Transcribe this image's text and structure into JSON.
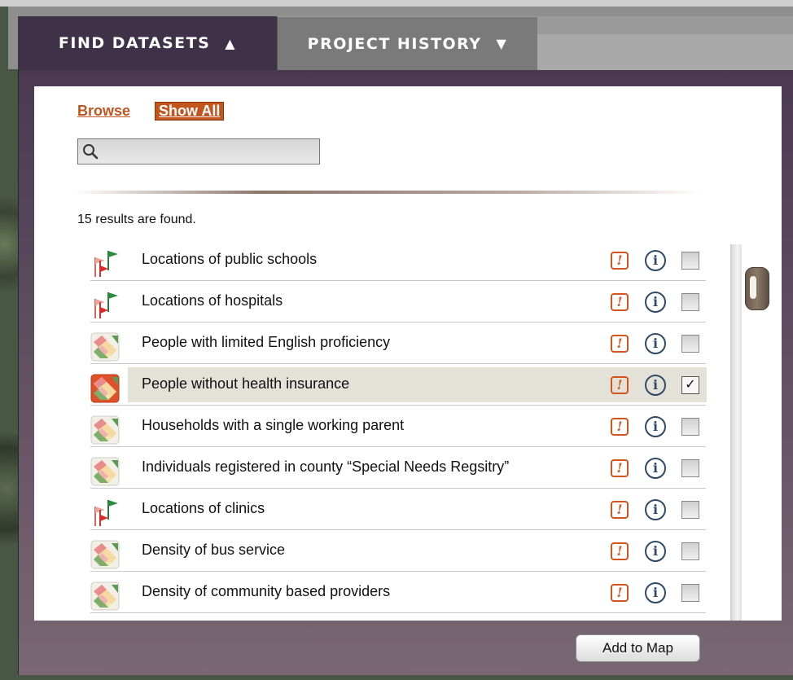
{
  "tabs": {
    "find": {
      "label": "FIND DATASETS",
      "arrow": "▲"
    },
    "history": {
      "label": "PROJECT HISTORY",
      "arrow": "▼"
    }
  },
  "links": {
    "browse": "Browse",
    "show_all": "Show All"
  },
  "search": {
    "value": "",
    "placeholder": ""
  },
  "result_count": "15 results are found.",
  "results": [
    {
      "icon": "flag-icon",
      "label": "Locations of public schools",
      "checked": false,
      "selected": false
    },
    {
      "icon": "flag-icon",
      "label": "Locations of hospitals",
      "checked": false,
      "selected": false
    },
    {
      "icon": "map-tile-icon",
      "label": "People with limited English proficiency",
      "checked": false,
      "selected": false
    },
    {
      "icon": "map-tile-icon",
      "label": "People without health insurance",
      "checked": true,
      "selected": true
    },
    {
      "icon": "map-tile-icon",
      "label": "Households with a single working parent",
      "checked": false,
      "selected": false
    },
    {
      "icon": "map-tile-icon",
      "label": "Individuals registered in county “Special Needs Regsitry”",
      "checked": false,
      "selected": false
    },
    {
      "icon": "flag-icon",
      "label": "Locations of clinics",
      "checked": false,
      "selected": false
    },
    {
      "icon": "map-tile-icon",
      "label": "Density of bus service",
      "checked": false,
      "selected": false
    },
    {
      "icon": "map-tile-icon",
      "label": "Density of community based providers",
      "checked": false,
      "selected": false
    }
  ],
  "warn_glyph": "!",
  "info_glyph": "i",
  "check_glyph": "✓",
  "add_button": "Add to Map",
  "colors": {
    "accent": "#c2541e",
    "panel": "#3f3147",
    "info": "#2e4a66"
  }
}
